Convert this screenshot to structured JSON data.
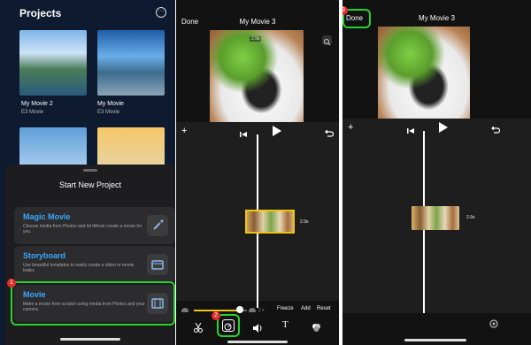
{
  "projects_panel": {
    "title": "Projects",
    "projects": [
      {
        "name": "My Movie 2",
        "meta": "E3 Movie"
      },
      {
        "name": "My Movie",
        "meta": "E3 Movie"
      }
    ],
    "sheet": {
      "title": "Start New Project",
      "cards": [
        {
          "title": "Magic Movie",
          "desc": "Choose media from Photos and let iMovie create a movie for you."
        },
        {
          "title": "Storyboard",
          "desc": "Use beautiful templates to easily create a video or movie trailer."
        },
        {
          "title": "Movie",
          "desc": "Make a movie from scratch using media from Photos and your camera."
        }
      ],
      "step_badge": "1"
    }
  },
  "editor_panel": {
    "done_label": "Done",
    "movie_title": "My Movie 3",
    "preview_duration": "2.9s",
    "clip_duration": "2.9s",
    "speed_label": "2 x",
    "actions": [
      "Freeze",
      "Add",
      "Reset"
    ],
    "step_badge": "2"
  },
  "done_panel": {
    "done_label": "Done",
    "movie_title": "My Movie 3",
    "clip_duration": "2.9s",
    "step_badge": "3"
  },
  "colors": {
    "highlight": "#27d12b",
    "badge": "#e62b2b",
    "link": "#3aa8ff",
    "speed_track": "#f1c40f"
  }
}
